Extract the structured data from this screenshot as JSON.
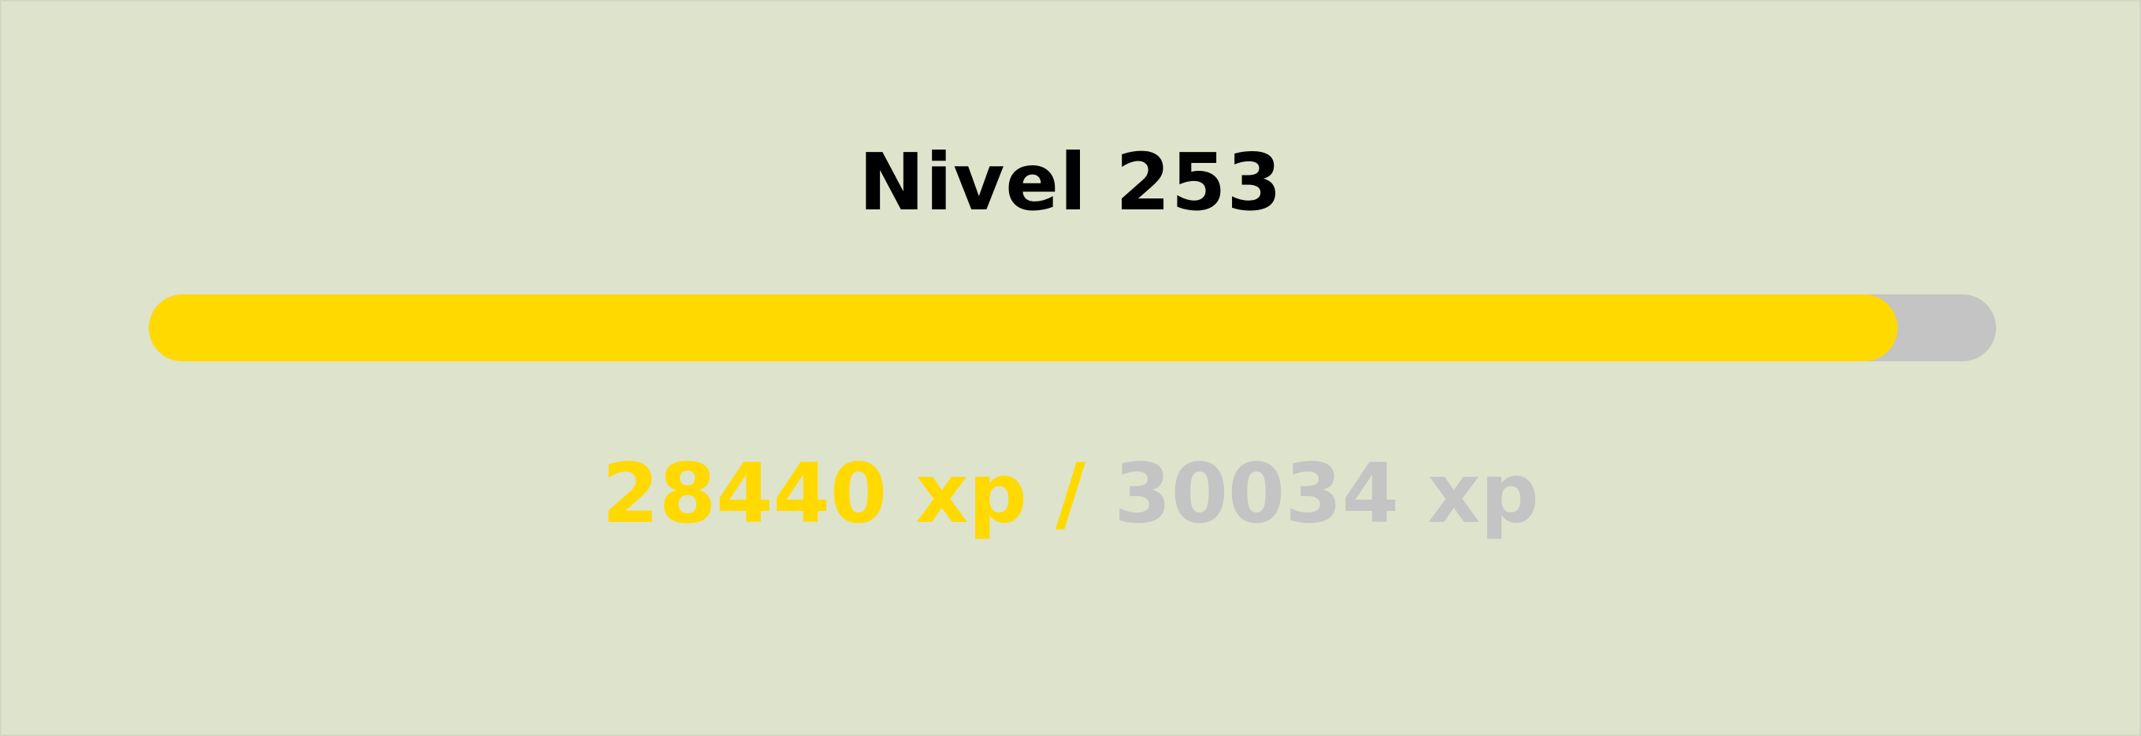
{
  "level": {
    "title": "Nivel 253"
  },
  "progress": {
    "fraction": 0.9469,
    "current_text": "28440 xp /",
    "required_text": "30034 xp"
  },
  "colors": {
    "background": "#dee3cc",
    "fill": "#ffd900",
    "track": "#c4c4c4",
    "title": "#000000"
  }
}
